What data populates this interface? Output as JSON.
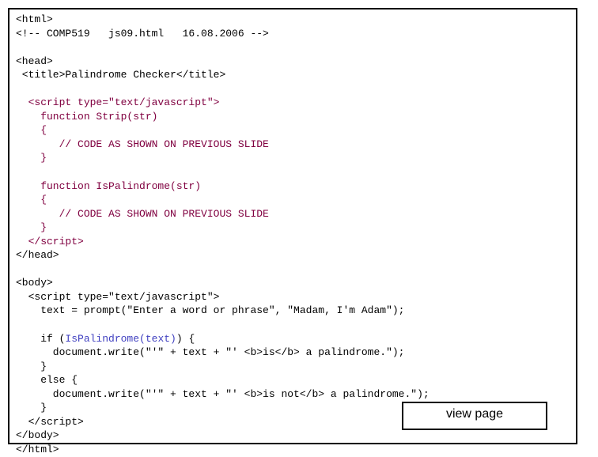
{
  "lines": [
    {
      "cls": "black",
      "text": "<html>"
    },
    {
      "cls": "black",
      "text": "<!-- COMP519   js09.html   16.08.2006 -->"
    },
    {
      "cls": "black",
      "text": ""
    },
    {
      "cls": "black",
      "text": "<head>"
    },
    {
      "cls": "black",
      "text": " <title>Palindrome Checker</title>"
    },
    {
      "cls": "black",
      "text": ""
    },
    {
      "cls": "maroon",
      "text": "  <script type=\"text/javascript\">"
    },
    {
      "cls": "maroon",
      "text": "    function Strip(str)"
    },
    {
      "cls": "maroon",
      "text": "    {"
    },
    {
      "cls": "maroon",
      "text": "       // CODE AS SHOWN ON PREVIOUS SLIDE"
    },
    {
      "cls": "maroon",
      "text": "    }"
    },
    {
      "cls": "maroon",
      "text": ""
    },
    {
      "cls": "maroon",
      "text": "    function IsPalindrome(str)"
    },
    {
      "cls": "maroon",
      "text": "    {"
    },
    {
      "cls": "maroon",
      "text": "       // CODE AS SHOWN ON PREVIOUS SLIDE"
    },
    {
      "cls": "maroon",
      "text": "    }"
    },
    {
      "cls": "maroon",
      "text": "  </script>"
    },
    {
      "cls": "black",
      "text": "</head>"
    },
    {
      "cls": "black",
      "text": ""
    },
    {
      "cls": "black",
      "text": "<body>"
    },
    {
      "cls": "black",
      "text": "  <script type=\"text/javascript\">"
    },
    {
      "cls": "black",
      "text": "    text = prompt(\"Enter a word or phrase\", \"Madam, I'm Adam\");"
    },
    {
      "cls": "black",
      "text": ""
    },
    {
      "segments": [
        {
          "cls": "black",
          "text": "    if ("
        },
        {
          "cls": "blue",
          "text": "IsPalindrome(text)"
        },
        {
          "cls": "black",
          "text": ") {"
        }
      ]
    },
    {
      "cls": "black",
      "text": "      document.write(\"'\" + text + \"' <b>is</b> a palindrome.\");"
    },
    {
      "cls": "black",
      "text": "    }"
    },
    {
      "cls": "black",
      "text": "    else {"
    },
    {
      "cls": "black",
      "text": "      document.write(\"'\" + text + \"' <b>is not</b> a palindrome.\");"
    },
    {
      "cls": "black",
      "text": "    }"
    },
    {
      "cls": "black",
      "text": "  </script>"
    },
    {
      "cls": "black",
      "text": "</body>"
    },
    {
      "cls": "black",
      "text": "</html>"
    }
  ],
  "button_label": "view page"
}
